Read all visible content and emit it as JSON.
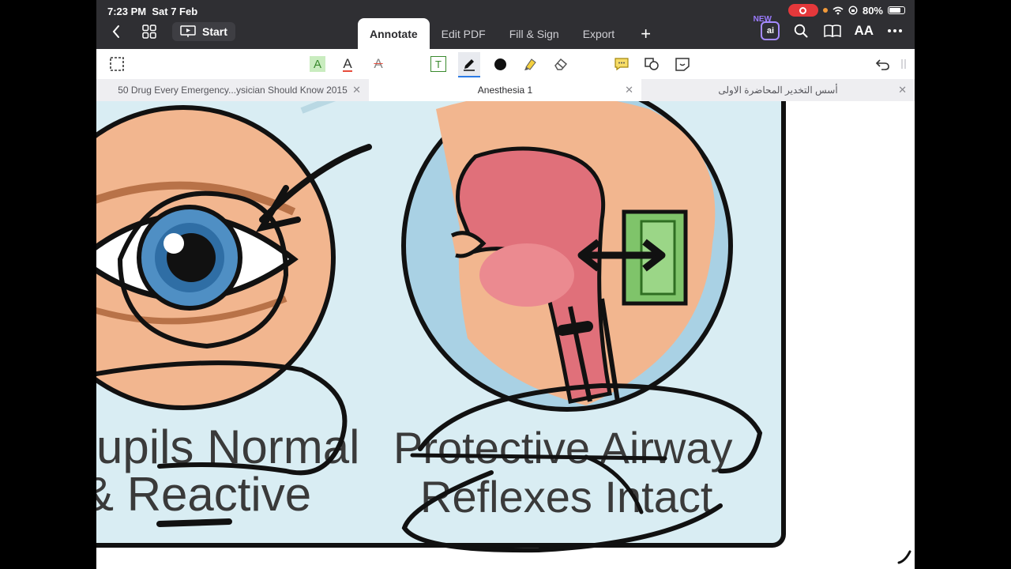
{
  "status": {
    "time": "7:23 PM",
    "date": "Sat 7 Feb",
    "battery": "80%",
    "battery_level": 0.8
  },
  "nav": {
    "start_label": "Start",
    "new_badge": "NEW",
    "ai_label": "ai",
    "text_size_label": "AA"
  },
  "tabs": [
    {
      "label": "Annotate",
      "active": true
    },
    {
      "label": "Edit PDF",
      "active": false
    },
    {
      "label": "Fill & Sign",
      "active": false
    },
    {
      "label": "Export",
      "active": false
    }
  ],
  "toolbar": {
    "highlight_letter": "A",
    "underline_letter": "A",
    "strike_letter": "A",
    "textbox_letter": "T",
    "colors": {
      "highlight": "#7bc96f",
      "underline": "#e74c3c",
      "strike": "#e74c3c",
      "pen": "#111111",
      "marker": "#f4d03f",
      "accent": "#2c7be5"
    }
  },
  "doc_tabs": [
    {
      "label": "50 Drug Every Emergency...ysician Should Know 2015",
      "active": false
    },
    {
      "label": "Anesthesia 1",
      "active": true
    },
    {
      "label": "أسس التخدير المحاضرة الاولى",
      "active": false
    }
  ],
  "document": {
    "left_caption_line1": "upils Normal",
    "left_caption_line2": "& Reactive",
    "right_caption_line1": "Protective Airway",
    "right_caption_line2": "Reflexes Intact",
    "colors": {
      "background": "#d9edf3",
      "skin": "#f2b68f",
      "iris": "#4f8fc4",
      "airway": "#e0707a",
      "green_box": "#7fc46a",
      "ink": "#111111"
    }
  }
}
